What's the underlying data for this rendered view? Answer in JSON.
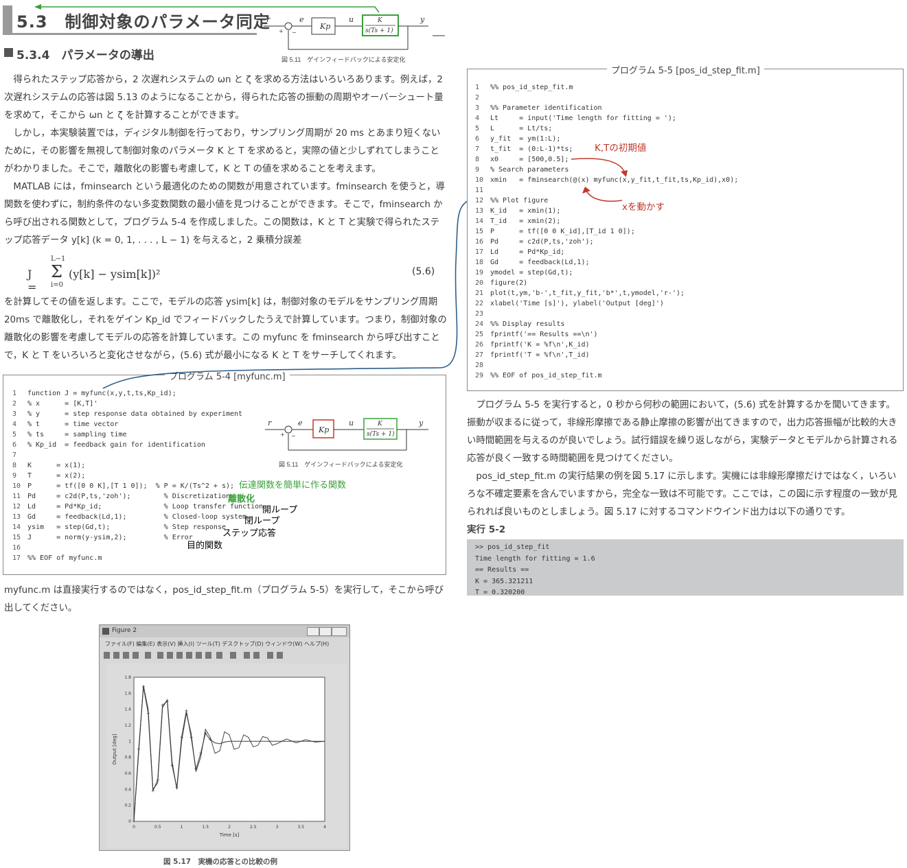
{
  "header": {
    "section_title": "5.3　制御対象のパラメータ同定",
    "subsection_title": "5.3.4　パラメータの導出"
  },
  "block_diagram": {
    "r": "r",
    "e": "e",
    "u": "u",
    "y": "y",
    "kp": "Kp",
    "plant_num": "K",
    "plant_den": "s(Ts + 1)",
    "plus": "+",
    "minus": "−",
    "caption": "図 5.11　ゲインフィードバックによる安定化"
  },
  "paragraphs": [
    "　得られたステップ応答から，2 次遅れシステムの ωn と ζ を求める方法はいろいろあります。例えば，2 次遅れシステムの応答は図 5.13 のようになることから，得られた応答の振動の周期やオーバーシュート量を求めて，そこから ωn と ζ を計算することができます。",
    "　しかし，本実験装置では，ディジタル制御を行っており，サンプリング周期が 20 ms とあまり短くないために，その影響を無視して制御対象のパラメータ K と T を求めると，実際の値と少しずれてしまうことがわかりました。そこで，離散化の影響も考慮して，K と T の値を求めることを考えます。",
    "　MATLAB には，fminsearch という最適化のための関数が用意されています。fminsearch を使うと，導関数を使わずに，制約条件のない多変数関数の最小値を見つけることができます。そこで，fminsearch から呼び出される関数として，プログラム 5-4 を作成しました。この関数は，K と T と実験で得られたステップ応答データ y[k] (k = 0, 1, . . . , L − 1) を与えると，2 乗積分誤差",
    "を計算してその値を返します。ここで，モデルの応答 ysim[k] は，制御対象のモデルをサンプリング周期 20ms で離散化し，それをゲイン Kp_id でフィードバックしたうえで計算しています。つまり，制御対象の離散化の影響を考慮してモデルの応答を計算しています。この myfunc を fminsearch から呼び出すことで，K と T をいろいろと変化させながら，(5.6) 式が最小になる K と T をサーチしてくれます。",
    "myfunc.m は直接実行するのではなく，pos_id_step_fit.m（プログラム 5-5）を実行して，そこから呼び出してください。"
  ],
  "equation": {
    "lhs": "J =",
    "sum_top": "L−1",
    "sum_bottom": "i=0",
    "sum": "Σ",
    "body": "(y[k] − ysim[k])²",
    "number": "(5.6)"
  },
  "program54": {
    "title": "プログラム 5-4 [myfunc.m]",
    "lines": [
      "function J = myfunc(x,y,t,ts,Kp_id);",
      "% x      = [K,T]'",
      "% y      = step response data obtained by experiment",
      "% t      = time vector",
      "% ts     = sampling time",
      "% Kp_id  = feedback gain for identification",
      "",
      "K      = x(1);",
      "T      = x(2);",
      "P      = tf([0 0 K],[T 1 0]);  % P = K/(Ts^2 + s);",
      "Pd     = c2d(P,ts,'zoh');        % Discretization",
      "Ld     = Pd*Kp_id;               % Loop transfer function",
      "Gd     = feedback(Ld,1);         % Closed-loop system",
      "ysim   = step(Gd,t);             % Step response",
      "J      = norm(y-ysim,2);         % Error",
      "",
      "%% EOF of myfunc.m"
    ],
    "annotations": {
      "tf": "伝達関数を簡単に作る関数",
      "disc": "離散化",
      "loop": "開ループ",
      "closed": "閉ループ",
      "step": "ステップ応答",
      "error": "目的関数"
    }
  },
  "program55": {
    "title": "プログラム 5-5 [pos_id_step_fit.m]",
    "lines": [
      "%% pos_id_step_fit.m",
      "",
      "%% Parameter identification",
      "Lt     = input('Time length for fitting = ');",
      "L      = Lt/ts;",
      "y_fit  = ym(1:L);",
      "t_fit  = (0:L-1)*ts;",
      "x0     = [500,0.5];",
      "% Search parameters",
      "xmin   = fminsearch(@(x) myfunc(x,y_fit,t_fit,ts,Kp_id),x0);",
      "",
      "%% Plot figure",
      "K_id   = xmin(1);",
      "T_id   = xmin(2);",
      "P      = tf([0 0 K_id],[T_id 1 0]);",
      "Pd     = c2d(P,ts,'zoh');",
      "Ld     = Pd*Kp_id;",
      "Gd     = feedback(Ld,1);",
      "ymodel = step(Gd,t);",
      "figure(2)",
      "plot(t,ym,'b-',t_fit,y_fit,'b*',t,ymodel,'r-');",
      "xlabel('Time [s]'), ylabel('Output [deg]')",
      "",
      "%% Display results",
      "fprintf('== Results ==\\n')",
      "fprintf('K = %f\\n',K_id)",
      "fprintf('T = %f\\n',T_id)",
      "",
      "%% EOF of pos_id_step_fit.m"
    ],
    "annotations": {
      "init": "K,Tの初期値",
      "vary": "xを動かす"
    }
  },
  "right_paragraphs": [
    "　プログラム 5-5 を実行すると，0 秒から何秒の範囲において，(5.6) 式を計算するかを聞いてきます。振動が収まるに従って，非線形摩擦である静止摩擦の影響が出てきますので，出力応答振幅が比較的大きい時間範囲を与えるのが良いでしょう。試行錯誤を繰り返しながら，実験データとモデルから計算される応答が良く一致する時間範囲を見つけてください。",
    "　pos_id_step_fit.m の実行結果の例を図 5.17 に示します。実機には非線形摩擦だけではなく，いろいろな不確定要素を含んでいますから，完全な一致は不可能です。ここでは，この図に示す程度の一致が見られれば良いものとしましょう。図 5.17 に対するコマンドウインド出力は以下の通りです。"
  ],
  "exec": {
    "label": "実行 5-2",
    "lines": [
      ">> pos_id_step_fit",
      "Time length for fitting = 1.6",
      "== Results ==",
      "K = 365.321211",
      "T = 0.320200"
    ]
  },
  "figure": {
    "window_title": "Figure 2",
    "menu": "ファイル(F)  編集(E)  表示(V)  挿入(I)  ツール(T)  デスクトップ(D)  ウィンドウ(W)  ヘルプ(H)",
    "caption": "図 5.17　実機の応答との比較の例",
    "xlabel": "Time [s]",
    "ylabel": "Output [deg]"
  },
  "chart_data": {
    "type": "line",
    "xlabel": "Time [s]",
    "ylabel": "Output [deg]",
    "xlim": [
      0,
      4
    ],
    "ylim": [
      0,
      1.8
    ],
    "xticks": [
      "0",
      "0.5",
      "1",
      "1.5",
      "2",
      "2.5",
      "3",
      "3.5",
      "4"
    ],
    "yticks": [
      "0",
      "0.2",
      "0.4",
      "0.6",
      "0.8",
      "1",
      "1.2",
      "1.4",
      "1.6",
      "1.8"
    ],
    "series": [
      {
        "x": [
          0,
          0.1,
          0.2,
          0.3,
          0.4,
          0.5,
          0.6,
          0.7,
          0.8,
          0.9,
          1.0,
          1.1,
          1.2,
          1.3,
          1.4,
          1.5,
          1.6,
          1.7,
          1.8,
          1.9,
          2.0,
          2.1,
          2.2,
          2.4,
          2.6,
          2.8,
          3.0,
          3.2,
          3.4,
          3.6,
          3.8,
          4.0
        ],
        "y": [
          0,
          0.9,
          1.68,
          1.35,
          0.38,
          0.52,
          1.45,
          1.5,
          0.7,
          0.42,
          1.05,
          1.38,
          1.05,
          0.65,
          0.85,
          1.1,
          1.02,
          0.98,
          0.97,
          0.99,
          1.0,
          1.0,
          1.0,
          1.0,
          1.0,
          1.0,
          1.0,
          1.0,
          1.0,
          1.0,
          1.0,
          1.0
        ]
      },
      {
        "x": [
          0,
          0.1,
          0.2,
          0.3,
          0.4,
          0.5,
          0.6,
          0.7,
          0.8,
          0.9,
          1.0,
          1.1,
          1.2,
          1.3,
          1.4,
          1.5,
          1.6,
          1.7,
          1.8,
          1.9,
          2.0,
          2.1,
          2.2,
          2.3,
          2.4,
          2.5,
          2.6,
          2.7,
          2.8,
          2.9,
          3.0,
          3.2,
          3.4,
          3.6,
          3.8,
          4.0
        ],
        "y": [
          0,
          0.85,
          1.7,
          1.4,
          0.4,
          0.48,
          1.42,
          1.52,
          0.75,
          0.4,
          1.0,
          1.35,
          1.1,
          0.62,
          0.8,
          1.15,
          1.05,
          0.85,
          0.88,
          1.12,
          1.08,
          0.9,
          0.92,
          1.08,
          1.05,
          0.93,
          0.95,
          1.06,
          1.04,
          0.95,
          0.97,
          1.03,
          0.98,
          1.02,
          0.99,
          1.0
        ]
      }
    ]
  }
}
